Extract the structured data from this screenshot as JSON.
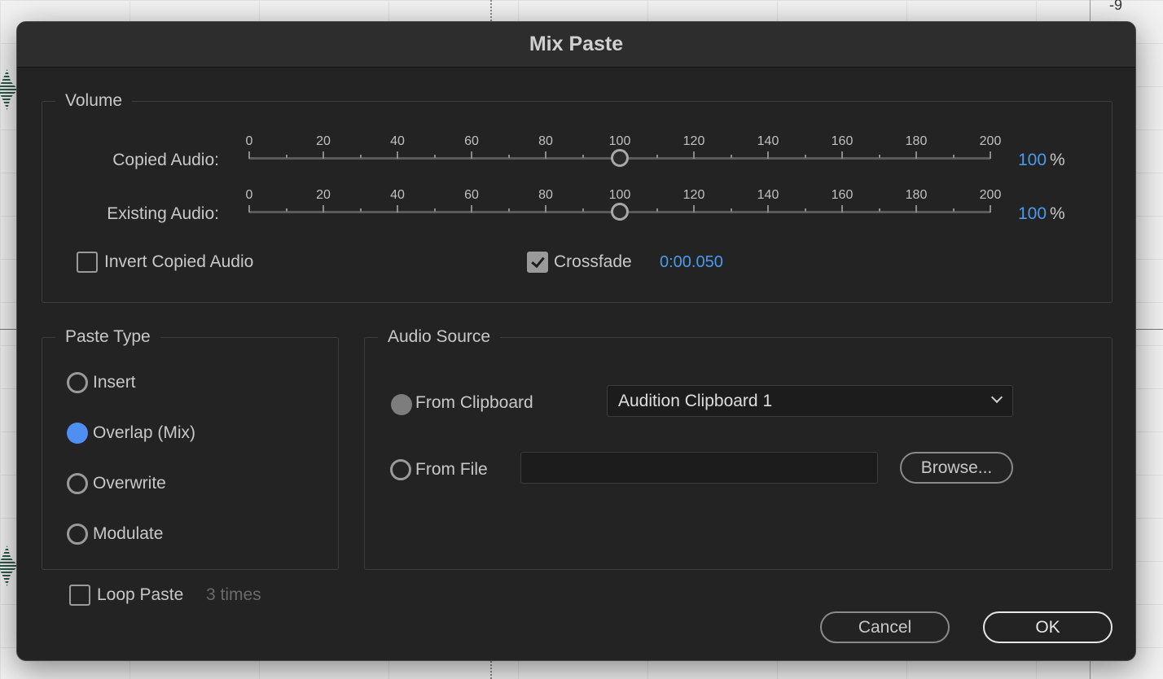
{
  "background": {
    "ruler_label": "-9"
  },
  "dialog": {
    "title": "Mix Paste"
  },
  "volume": {
    "legend": "Volume",
    "scale_ticks": [
      "0",
      "20",
      "40",
      "60",
      "80",
      "100",
      "120",
      "140",
      "160",
      "180",
      "200"
    ],
    "copied_audio": {
      "label": "Copied Audio:",
      "value": "100",
      "unit": "%",
      "level": 100
    },
    "existing_audio": {
      "label": "Existing Audio:",
      "value": "100",
      "unit": "%",
      "level": 100
    },
    "invert_copied_audio": {
      "label": "Invert Copied Audio",
      "checked": false
    },
    "crossfade": {
      "label": "Crossfade",
      "checked": true,
      "value": "0:00.050"
    }
  },
  "paste_type": {
    "legend": "Paste Type",
    "options": [
      {
        "label": "Insert",
        "selected": false
      },
      {
        "label": "Overlap (Mix)",
        "selected": true
      },
      {
        "label": "Overwrite",
        "selected": false
      },
      {
        "label": "Modulate",
        "selected": false
      }
    ]
  },
  "audio_source": {
    "legend": "Audio Source",
    "from_clipboard": {
      "label": "From Clipboard",
      "selected": true,
      "dropdown_value": "Audition Clipboard 1"
    },
    "from_file": {
      "label": "From File",
      "selected": false,
      "value": ""
    },
    "browse_label": "Browse..."
  },
  "loop_paste": {
    "label": "Loop Paste",
    "checked": false,
    "times_text": "3 times"
  },
  "buttons": {
    "cancel": "Cancel",
    "ok": "OK"
  },
  "colors": {
    "accent": "#4a9aee",
    "radio_selected": "#4f8ff2",
    "dialog_bg": "#232323"
  }
}
